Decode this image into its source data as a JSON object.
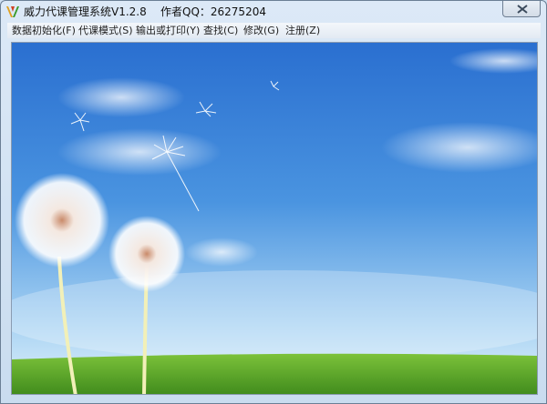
{
  "window": {
    "title": "威力代课管理系统V1.2.8    作者QQ：26275204",
    "icon": "app-logo-icon",
    "close_icon": "close-icon"
  },
  "menu": {
    "items": [
      {
        "label": "数据初始化(F)"
      },
      {
        "label": "代课模式(S)"
      },
      {
        "label": "输出或打印(Y)"
      },
      {
        "label": "查找(C)"
      },
      {
        "label": "修改(G)"
      },
      {
        "label": "注册(Z)"
      }
    ]
  },
  "wallpaper": {
    "description_icon": "dandelion-wallpaper",
    "sky_top": "#2a6fd0",
    "sky_bottom": "#d8eefc",
    "grass": "#5fa62a"
  }
}
